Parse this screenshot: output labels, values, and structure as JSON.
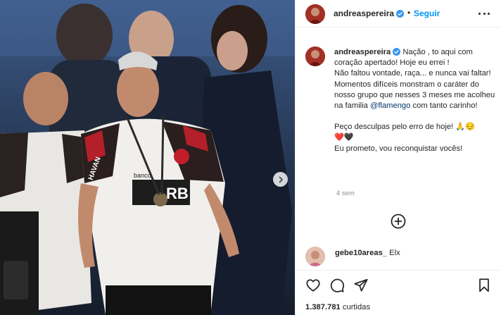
{
  "post": {
    "username": "andreaspereira",
    "follow_label": "Seguir",
    "separator": "•"
  },
  "caption": {
    "username": "andreaspereira",
    "line1": "Nação , to aqui com coração apertado! Hoje eu errei !",
    "line2": "Não faltou vontade, raça... e nunca vai faltar!",
    "line3_before": "Momentos difíceis monstram o caráter do nosso grupo que nesses 3 meses me acolheu na familia ",
    "mention": "@flamengo",
    "line3_after": " com tanto carinho!",
    "line4": "Peço desculpas pelo erro de hoje! 🙏😔",
    "line5_emoji": "❤️🖤",
    "line6": "Eu prometo, vou reconquistar vocês!",
    "time_ago": "4 sem"
  },
  "comment": {
    "username": "gebe10areas_",
    "text": "Elx"
  },
  "likes": {
    "count": "1.387.781",
    "label": "curtidas"
  },
  "photo": {
    "jersey_text": "RB",
    "sponsor_top": "banco",
    "name_patch": "HAVAN"
  },
  "icons": {
    "verified": "verified-badge-icon",
    "more": "more-options-icon",
    "like": "heart-icon",
    "comment": "comment-icon",
    "share": "share-icon",
    "save": "bookmark-icon",
    "load_more": "plus-circle-icon",
    "carousel": "chevron-right-icon"
  },
  "colors": {
    "link": "#0095f6",
    "mention": "#00376b",
    "muted": "#8e8e8e",
    "text": "#262626"
  }
}
